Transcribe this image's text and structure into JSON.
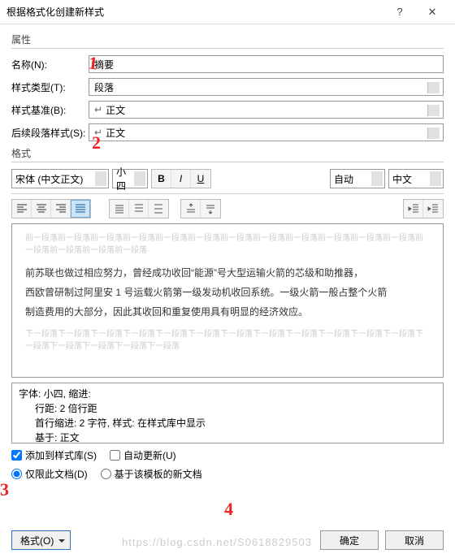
{
  "title": "根据格式化创建新样式",
  "titlebar": {
    "help": "?",
    "close": "✕"
  },
  "props": {
    "group": "属性",
    "name_label": "名称(N):",
    "name_value": "摘要",
    "type_label": "样式类型(T):",
    "type_value": "段落",
    "based_label": "样式基准(B):",
    "based_value": "正文",
    "next_label": "后续段落样式(S):",
    "next_value": "正文"
  },
  "format": {
    "group": "格式",
    "font": "宋体 (中文正文)",
    "size": "小四",
    "color": "自动",
    "lang": "中文"
  },
  "preview": {
    "ghost_top": "前一段落前一段落前一段落前一段落前一段落前一段落前一段落前一段落前一段落前一段落前一段落前一段落前一段落前一段落前一段落前一段落",
    "p1": "前苏联也做过相应努力，曾经成功收回“能源”号大型运输火箭的芯级和助推器，",
    "p2": "西欧曾研制过阿里安 1 号运载火箭第一级发动机收回系统。一级火箭一般占整个火箭",
    "p3": "制造费用的大部分，因此其收回和重复使用具有明显的经济效应。",
    "ghost_bottom": "下一段落下一段落下一段落下一段落下一段落下一段落下一段落下一段落下一段落下一段落下一段落下一段落下一段落下一段落下一段落下一段落下一段落"
  },
  "summary": {
    "l1": "字体: 小四, 缩进:",
    "l2": "行距: 2 倍行距",
    "l3": "首行缩进:  2 字符, 样式: 在样式库中显示",
    "l4": "基于: 正文"
  },
  "opts": {
    "add_gallery": "添加到样式库(S)",
    "auto_update": "自动更新(U)",
    "only_doc": "仅限此文档(D)",
    "new_template": "基于该模板的新文档"
  },
  "buttons": {
    "format": "格式(O)",
    "ok": "确定",
    "cancel": "取消"
  },
  "annot": {
    "a1": "1",
    "a2": "2",
    "a3": "3",
    "a4": "4"
  },
  "watermark": "https://blog.csdn.net/S0618829503"
}
